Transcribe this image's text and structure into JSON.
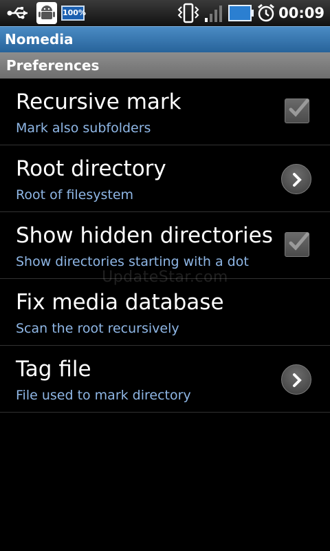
{
  "status_bar": {
    "battery_badge": "100%",
    "time": "00:09",
    "icons": [
      "usb-icon",
      "android-debug-icon",
      "battery-badge-icon",
      "vibrate-icon",
      "signal-icon",
      "battery-icon",
      "alarm-icon"
    ]
  },
  "app": {
    "title": "Nomedia"
  },
  "category": {
    "label": "Preferences"
  },
  "prefs": [
    {
      "title": "Recursive mark",
      "summary": "Mark also subfolders",
      "widget": "checkbox",
      "checked": true
    },
    {
      "title": "Root directory",
      "summary": "Root of filesystem",
      "widget": "chevron"
    },
    {
      "title": "Show hidden directories",
      "summary": "Show directories starting with a dot",
      "widget": "checkbox",
      "checked": true
    },
    {
      "title": "Fix media database",
      "summary": "Scan the root recursively",
      "widget": "none"
    },
    {
      "title": "Tag file",
      "summary": "File used to mark directory",
      "widget": "chevron"
    }
  ],
  "watermark": "UpdateStar.com",
  "colors": {
    "title_bar": "#3a78b3",
    "summary_text": "#8fb7e6",
    "category_bg": "#7d7d7d"
  }
}
